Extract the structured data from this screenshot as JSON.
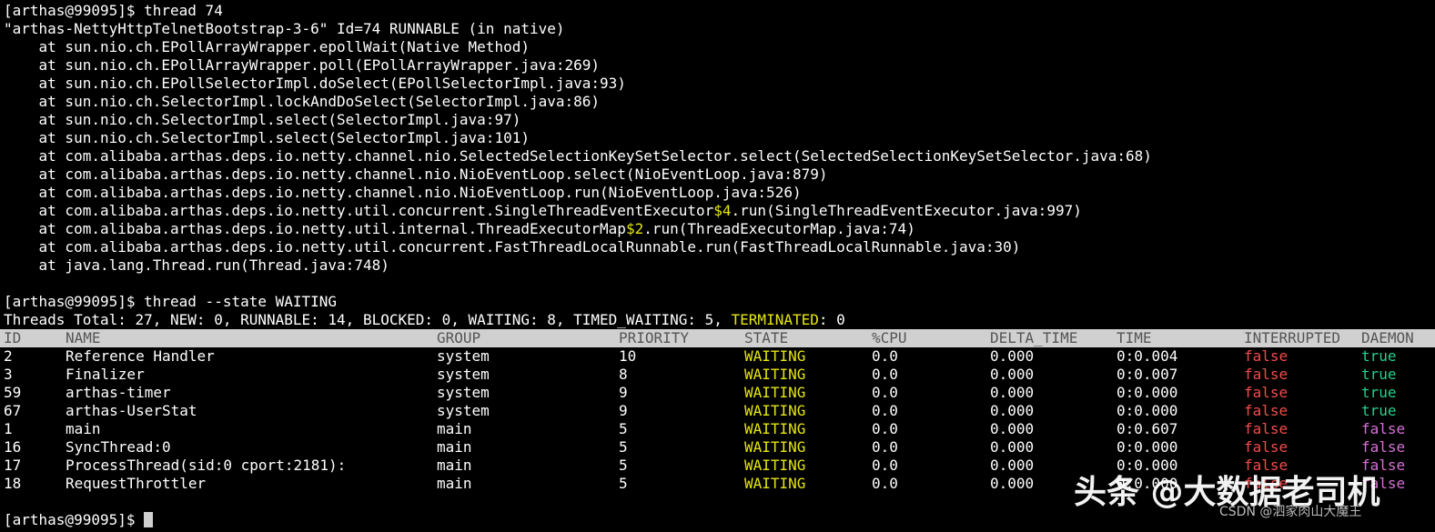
{
  "terminal": {
    "stack_lines": [
      {
        "segs": [
          {
            "t": "[arthas@99095]$ thread 74",
            "c": ""
          }
        ]
      },
      {
        "segs": [
          {
            "t": "\"arthas-NettyHttpTelnetBootstrap-3-6\" Id=74 RUNNABLE (in native)",
            "c": ""
          }
        ]
      },
      {
        "segs": [
          {
            "t": "    at sun.nio.ch.EPollArrayWrapper.epollWait(Native Method)",
            "c": ""
          }
        ]
      },
      {
        "segs": [
          {
            "t": "    at sun.nio.ch.EPollArrayWrapper.poll(EPollArrayWrapper.java:269)",
            "c": ""
          }
        ]
      },
      {
        "segs": [
          {
            "t": "    at sun.nio.ch.EPollSelectorImpl.doSelect(EPollSelectorImpl.java:93)",
            "c": ""
          }
        ]
      },
      {
        "segs": [
          {
            "t": "    at sun.nio.ch.SelectorImpl.lockAndDoSelect(SelectorImpl.java:86)",
            "c": ""
          }
        ]
      },
      {
        "segs": [
          {
            "t": "    at sun.nio.ch.SelectorImpl.select(SelectorImpl.java:97)",
            "c": ""
          }
        ]
      },
      {
        "segs": [
          {
            "t": "    at sun.nio.ch.SelectorImpl.select(SelectorImpl.java:101)",
            "c": ""
          }
        ]
      },
      {
        "segs": [
          {
            "t": "    at com.alibaba.arthas.deps.io.netty.channel.nio.SelectedSelectionKeySetSelector.select(SelectedSelectionKeySetSelector.java:68)",
            "c": ""
          }
        ]
      },
      {
        "segs": [
          {
            "t": "    at com.alibaba.arthas.deps.io.netty.channel.nio.NioEventLoop.select(NioEventLoop.java:879)",
            "c": ""
          }
        ]
      },
      {
        "segs": [
          {
            "t": "    at com.alibaba.arthas.deps.io.netty.channel.nio.NioEventLoop.run(NioEventLoop.java:526)",
            "c": ""
          }
        ]
      },
      {
        "segs": [
          {
            "t": "    at com.alibaba.arthas.deps.io.netty.util.concurrent.SingleThreadEventExecutor",
            "c": ""
          },
          {
            "t": "$4",
            "c": "yellow"
          },
          {
            "t": ".run(SingleThreadEventExecutor.java:997)",
            "c": ""
          }
        ]
      },
      {
        "segs": [
          {
            "t": "    at com.alibaba.arthas.deps.io.netty.util.internal.ThreadExecutorMap",
            "c": ""
          },
          {
            "t": "$2",
            "c": "yellow"
          },
          {
            "t": ".run(ThreadExecutorMap.java:74)",
            "c": ""
          }
        ]
      },
      {
        "segs": [
          {
            "t": "    at com.alibaba.arthas.deps.io.netty.util.concurrent.FastThreadLocalRunnable.run(FastThreadLocalRunnable.java:30)",
            "c": ""
          }
        ]
      },
      {
        "segs": [
          {
            "t": "    at java.lang.Thread.run(Thread.java:748)",
            "c": ""
          }
        ]
      }
    ],
    "command_line": [
      {
        "t": "[arthas@99095]$ thread --state WAITING",
        "c": ""
      }
    ],
    "summary_line": [
      {
        "t": "Threads Total: 27, NEW: 0, RUNNABLE: 14, BLOCKED: 0, WAITING: 8, TIMED_WAITING: 5, ",
        "c": ""
      },
      {
        "t": "TERMINATED",
        "c": "yellow"
      },
      {
        "t": ": 0",
        "c": ""
      }
    ],
    "prompt": "[arthas@99095]$ "
  },
  "table": {
    "columns": [
      "ID",
      "NAME",
      "GROUP",
      "PRIORITY",
      "STATE",
      "%CPU",
      "DELTA_TIME",
      "TIME",
      "INTERRUPTED",
      "DAEMON"
    ],
    "rows": [
      [
        "2",
        "Reference Handler",
        "system",
        "10",
        "WAITING",
        "0.0",
        "0.000",
        "0:0.004",
        "false",
        "true"
      ],
      [
        "3",
        "Finalizer",
        "system",
        "8",
        "WAITING",
        "0.0",
        "0.000",
        "0:0.007",
        "false",
        "true"
      ],
      [
        "59",
        "arthas-timer",
        "system",
        "9",
        "WAITING",
        "0.0",
        "0.000",
        "0:0.000",
        "false",
        "true"
      ],
      [
        "67",
        "arthas-UserStat",
        "system",
        "9",
        "WAITING",
        "0.0",
        "0.000",
        "0:0.000",
        "false",
        "true"
      ],
      [
        "1",
        "main",
        "main",
        "5",
        "WAITING",
        "0.0",
        "0.000",
        "0:0.607",
        "false",
        "false"
      ],
      [
        "16",
        "SyncThread:0",
        "main",
        "5",
        "WAITING",
        "0.0",
        "0.000",
        "0:0.000",
        "false",
        "false"
      ],
      [
        "17",
        "ProcessThread(sid:0 cport:2181):",
        "main",
        "5",
        "WAITING",
        "0.0",
        "0.000",
        "0:0.000",
        "false",
        "false"
      ],
      [
        "18",
        "RequestThrottler",
        "main",
        "5",
        "WAITING",
        "0.0",
        "0.000",
        "0:0.000",
        "false",
        "false"
      ]
    ]
  },
  "watermark": {
    "main": "头条 @大数据老司机",
    "sub": "CSDN @泗家肉山大魔王"
  },
  "colors": {
    "background": "#000000",
    "text": "#ffffff",
    "state_waiting": "#e5e510",
    "interrupted_false": "#f14c4c",
    "daemon_true": "#23d18b",
    "daemon_false": "#d670d6",
    "header_bg": "#d0d0d0"
  }
}
